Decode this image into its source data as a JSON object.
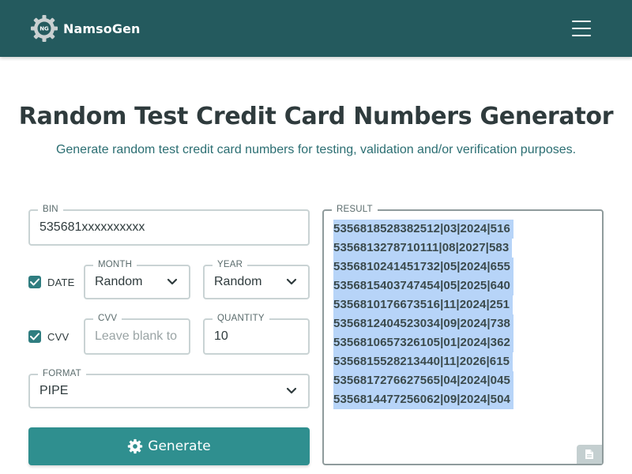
{
  "navbar": {
    "brand_name": "NamsoGen",
    "logo_text": "NG",
    "logo_icon": "gear-logo-icon",
    "menu_icon": "hamburger-menu-icon",
    "background": "#245a5e"
  },
  "header": {
    "title": "Random Test Credit Card Numbers Generator",
    "subtitle": "Generate random test credit card numbers for testing, validation and/or verification purposes."
  },
  "form": {
    "bin": {
      "label": "BIN",
      "value": "535681xxxxxxxxxx"
    },
    "date": {
      "checkbox_label": "DATE",
      "checked": true,
      "month": {
        "label": "MONTH",
        "value": "Random"
      },
      "year": {
        "label": "YEAR",
        "value": "Random"
      }
    },
    "cvv": {
      "checkbox_label": "CVV",
      "checked": true,
      "field": {
        "label": "CVV",
        "placeholder": "Leave blank to"
      }
    },
    "quantity": {
      "label": "QUANTITY",
      "value": "10"
    },
    "format": {
      "label": "FORMAT",
      "value": "PIPE"
    },
    "generate_button": {
      "label": "Generate",
      "icon": "gear-icon",
      "color": "#2f8f8f"
    }
  },
  "result": {
    "label": "RESULT",
    "lines": [
      "5356818528382512|03|2024|516",
      "5356813278710111|08|2027|583",
      "5356810241451732|05|2024|655",
      "5356815403747454|05|2025|640",
      "5356810176673516|11|2024|251",
      "5356812404523034|09|2024|738",
      "5356810657326105|01|2024|362",
      "5356815528213440|11|2026|615",
      "5356817276627565|04|2024|045",
      "5356814477256062|09|2024|504"
    ],
    "copy_icon": "document-copy-icon",
    "selection_color": "#b7d4f8"
  }
}
